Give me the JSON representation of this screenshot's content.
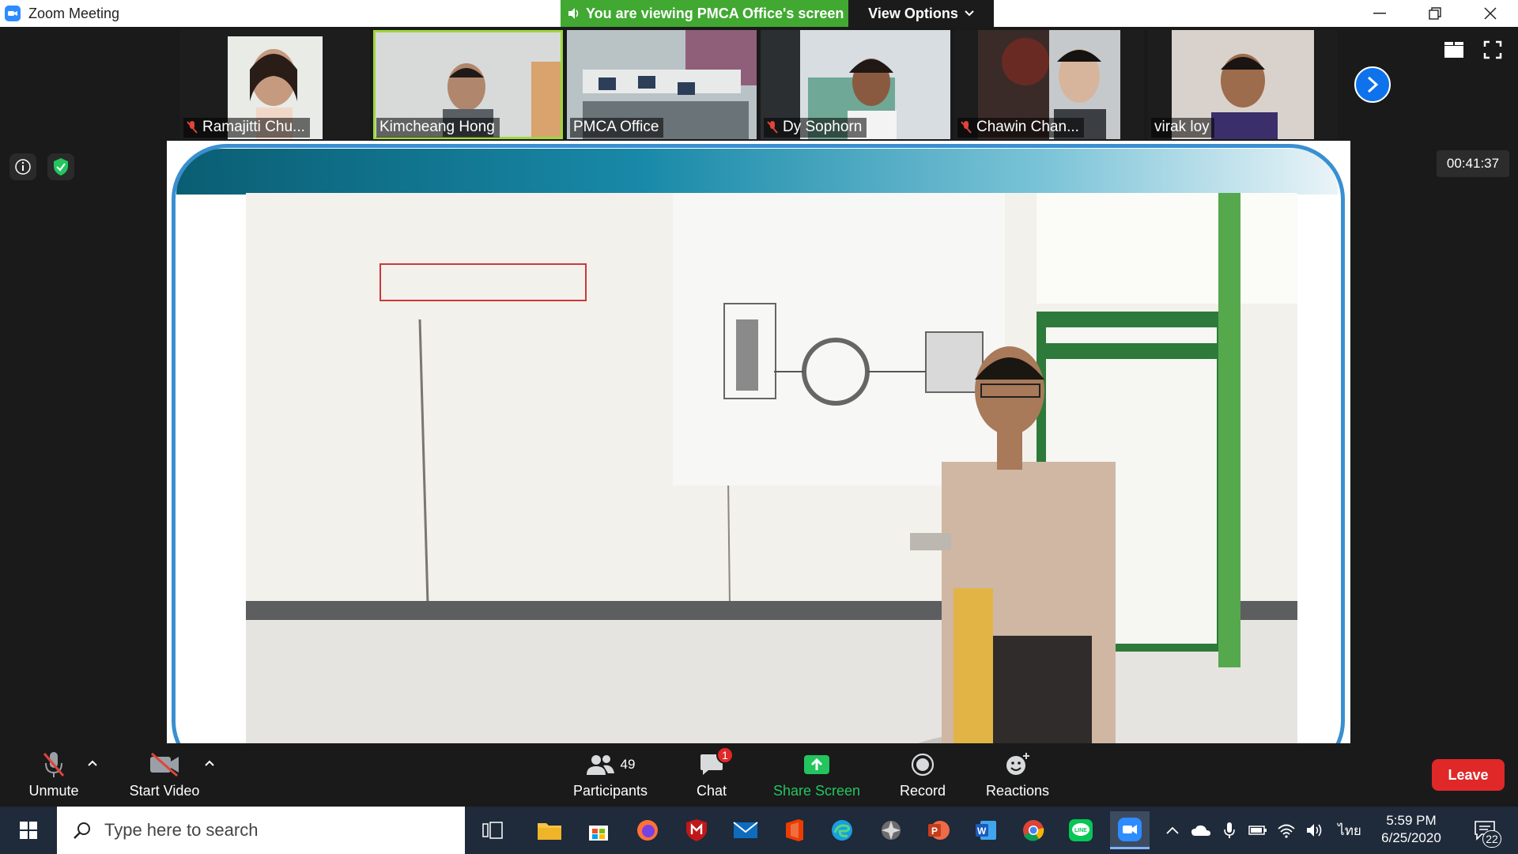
{
  "window": {
    "title": "Zoom Meeting"
  },
  "banner": {
    "viewing_text": "You are viewing PMCA Office's screen",
    "view_options_label": "View Options"
  },
  "participants": [
    {
      "name": "Ramajitti Chu...",
      "muted": true
    },
    {
      "name": "Kimcheang Hong",
      "muted": false,
      "active": true
    },
    {
      "name": "PMCA Office",
      "muted": false
    },
    {
      "name": "Dy Sophorn",
      "muted": true
    },
    {
      "name": "Chawin Chan...",
      "muted": true
    },
    {
      "name": "virak loy",
      "muted": false
    }
  ],
  "timer": "00:41:37",
  "toolbar": {
    "unmute_label": "Unmute",
    "start_video_label": "Start Video",
    "participants_label": "Participants",
    "participants_count": "49",
    "chat_label": "Chat",
    "chat_badge": "1",
    "share_screen_label": "Share Screen",
    "record_label": "Record",
    "reactions_label": "Reactions",
    "leave_label": "Leave"
  },
  "taskbar": {
    "search_placeholder": "Type here to search",
    "language": "ไทย",
    "time": "5:59 PM",
    "date": "6/25/2020",
    "notifications": "22"
  },
  "colors": {
    "zoom_blue": "#2d8cff",
    "banner_green": "#41a932",
    "share_green": "#22c55e",
    "leave_red": "#e02828",
    "active_speaker": "#9fd63d"
  }
}
